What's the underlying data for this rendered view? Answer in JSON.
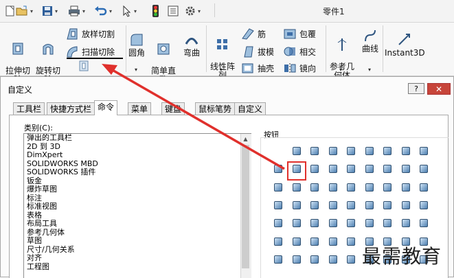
{
  "window": {
    "title": "零件1"
  },
  "ribbon": {
    "extrude_cut": "拉伸切\n除",
    "revolve_cut": "旋转切\n除",
    "loft_cut": "放样切割",
    "sweep_cut": "扫描切除",
    "fillet": "圆角",
    "simple_hole": "简单直\n孔",
    "dome": "弯曲",
    "linear_pattern": "线性阵\n列",
    "rib": "筋",
    "draft": "拔模",
    "shell": "抽壳",
    "wrap": "包覆",
    "intersect": "相交",
    "mirror": "镜向",
    "ref_geometry": "参考几\n何体",
    "curves": "曲线",
    "instant3d": "Instant3D"
  },
  "dialog": {
    "title": "自定义",
    "help": "?",
    "close": "✕",
    "tabs": [
      "工具栏",
      "快捷方式栏",
      "命令",
      "菜单",
      "键盘",
      "鼠标笔势",
      "自定义"
    ],
    "active_tab": "命令",
    "category_label": "类别(C):",
    "categories": [
      "弹出的工具栏",
      "2D 到 3D",
      "DimXpert",
      "SOLIDWORKS MBD",
      "SOLIDWORKS 插件",
      "钣金",
      "爆炸草图",
      "标注",
      "标准视图",
      "表格",
      "布局工具",
      "参考几何体",
      "草图",
      "尺寸/几何关系",
      "对齐",
      "工程图"
    ],
    "buttons_label": "按钮"
  },
  "watermark": "最需教育",
  "colors": {
    "highlight": "#e0302c",
    "accent": "#3b6ea5"
  }
}
